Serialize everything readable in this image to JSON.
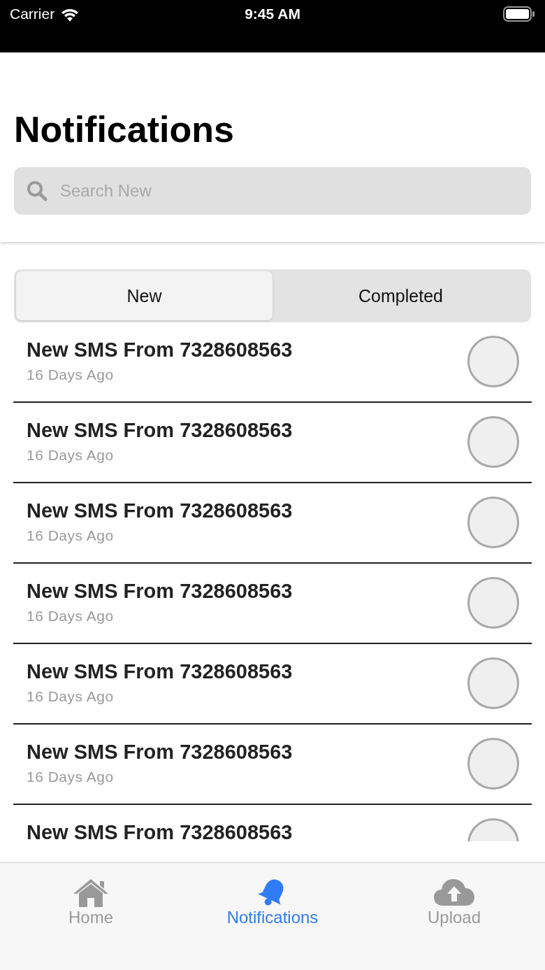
{
  "status_bar": {
    "carrier": "Carrier",
    "time": "9:45 AM"
  },
  "header": {
    "title": "Notifications",
    "search": {
      "placeholder": "Search New"
    }
  },
  "segments": [
    {
      "label": "New",
      "selected": true
    },
    {
      "label": "Completed",
      "selected": false
    }
  ],
  "notifications": [
    {
      "title": "New SMS From 7328608563",
      "time": "16 Days Ago",
      "checked": false
    },
    {
      "title": "New SMS From 7328608563",
      "time": "16 Days Ago",
      "checked": false
    },
    {
      "title": "New SMS From 7328608563",
      "time": "16 Days Ago",
      "checked": false
    },
    {
      "title": "New SMS From 7328608563",
      "time": "16 Days Ago",
      "checked": false
    },
    {
      "title": "New SMS From 7328608563",
      "time": "16 Days Ago",
      "checked": false
    },
    {
      "title": "New SMS From 7328608563",
      "time": "16 Days Ago",
      "checked": false
    },
    {
      "title": "New SMS From 7328608563",
      "checked": false
    }
  ],
  "tab_bar": [
    {
      "kind": "home",
      "label": "Home",
      "selected": false
    },
    {
      "kind": "bell",
      "label": "Notifications",
      "selected": true
    },
    {
      "kind": "upload",
      "label": "Upload",
      "selected": false
    }
  ]
}
